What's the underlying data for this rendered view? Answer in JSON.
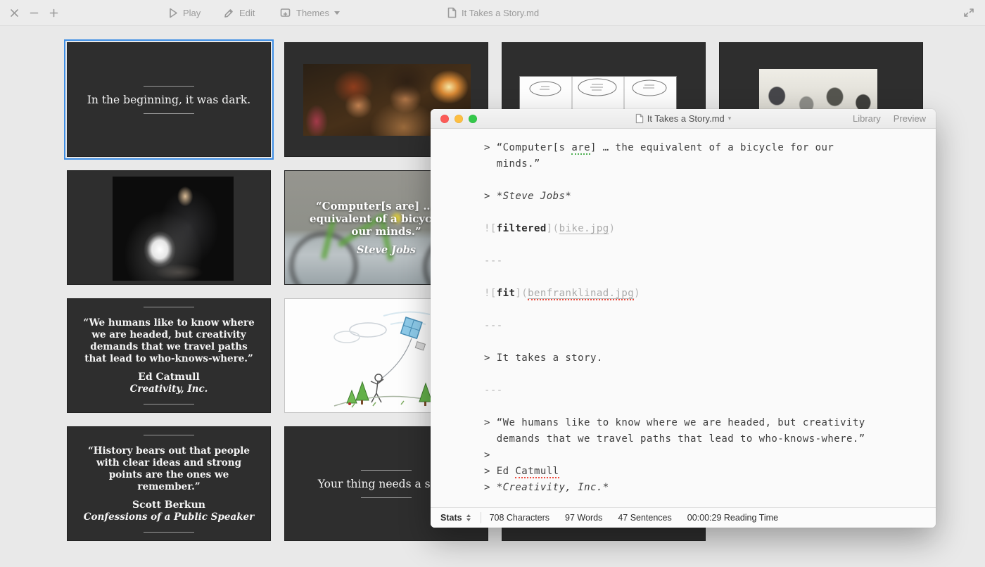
{
  "toolbar": {
    "play_label": "Play",
    "edit_label": "Edit",
    "themes_label": "Themes",
    "document_title": "It Takes a Story.md"
  },
  "editor": {
    "title": "It Takes a Story.md",
    "library_label": "Library",
    "preview_label": "Preview",
    "lines": [
      {
        "seg": [
          {
            "t": "> “Computer[s ",
            "c": "p"
          },
          {
            "t": "are",
            "c": "p g"
          },
          {
            "t": "] … the equivalent of a bicycle for our",
            "c": "p"
          }
        ]
      },
      {
        "seg": [
          {
            "t": "  minds.”",
            "c": "p"
          }
        ]
      },
      {
        "seg": []
      },
      {
        "seg": [
          {
            "t": "> ",
            "c": "p"
          },
          {
            "t": "*Steve Jobs*",
            "c": "i"
          }
        ]
      },
      {
        "seg": []
      },
      {
        "seg": [
          {
            "t": "![",
            "c": "s"
          },
          {
            "t": "filtered",
            "c": "b"
          },
          {
            "t": "](",
            "c": "s"
          },
          {
            "t": "bike.jpg",
            "c": "l"
          },
          {
            "t": ")",
            "c": "s"
          }
        ]
      },
      {
        "seg": []
      },
      {
        "seg": [
          {
            "t": "---",
            "c": "s"
          }
        ]
      },
      {
        "seg": []
      },
      {
        "seg": [
          {
            "t": "![",
            "c": "s"
          },
          {
            "t": "fit",
            "c": "b"
          },
          {
            "t": "](",
            "c": "s"
          },
          {
            "t": "benfranklinad.jpg",
            "c": "l r"
          },
          {
            "t": ")",
            "c": "s"
          }
        ]
      },
      {
        "seg": []
      },
      {
        "seg": [
          {
            "t": "---",
            "c": "s"
          }
        ]
      },
      {
        "seg": []
      },
      {
        "seg": [
          {
            "t": "> It takes a story.",
            "c": "p"
          }
        ]
      },
      {
        "seg": []
      },
      {
        "seg": [
          {
            "t": "---",
            "c": "s"
          }
        ]
      },
      {
        "seg": []
      },
      {
        "seg": [
          {
            "t": "> “We humans like to know where we are headed, but creativity",
            "c": "p"
          }
        ]
      },
      {
        "seg": [
          {
            "t": "  demands that we travel paths that lead to who-knows-where.”",
            "c": "p"
          }
        ]
      },
      {
        "seg": [
          {
            "t": ">",
            "c": "p"
          }
        ]
      },
      {
        "seg": [
          {
            "t": "> Ed ",
            "c": "p"
          },
          {
            "t": "Catmull",
            "c": "p r"
          }
        ]
      },
      {
        "seg": [
          {
            "t": "> ",
            "c": "p"
          },
          {
            "t": "*Creativity, Inc.*",
            "c": "i"
          }
        ]
      }
    ],
    "stats": {
      "label": "Stats",
      "items": [
        "708 Characters",
        "97 Words",
        "47 Sentences",
        "00:00:29 Reading Time"
      ]
    }
  },
  "slides": [
    {
      "label": "In the beginning, it was dark.",
      "selected": true
    },
    {
      "image": "croods-fire-scene"
    },
    {
      "image": "caveman-wheel-comic"
    },
    {
      "image": "early-light-bulbs-photo"
    },
    {
      "image": "tesla-glowing-bulb-photo"
    },
    {
      "quote": "“Computer[s are] … the equivalent of a bicycle for our minds.”",
      "attribution": "Steve Jobs",
      "image": "blurred-bicycle-photo"
    },
    {
      "quote": "“We humans like to know where we are headed, but creativity demands that we travel paths that lead to who-knows-where.”",
      "attribution": "Ed Catmull",
      "source": "Creativity, Inc."
    },
    {
      "image": "franklin-kite-sketch"
    },
    {
      "quote": "“History bears out that people with clear ideas and strong points are the ones we remember.”",
      "attribution": "Scott Berkun",
      "source": "Confessions of a Public Speaker"
    },
    {
      "label": "Your thing needs a story."
    },
    {
      "image": "partially-hidden-slide"
    }
  ]
}
